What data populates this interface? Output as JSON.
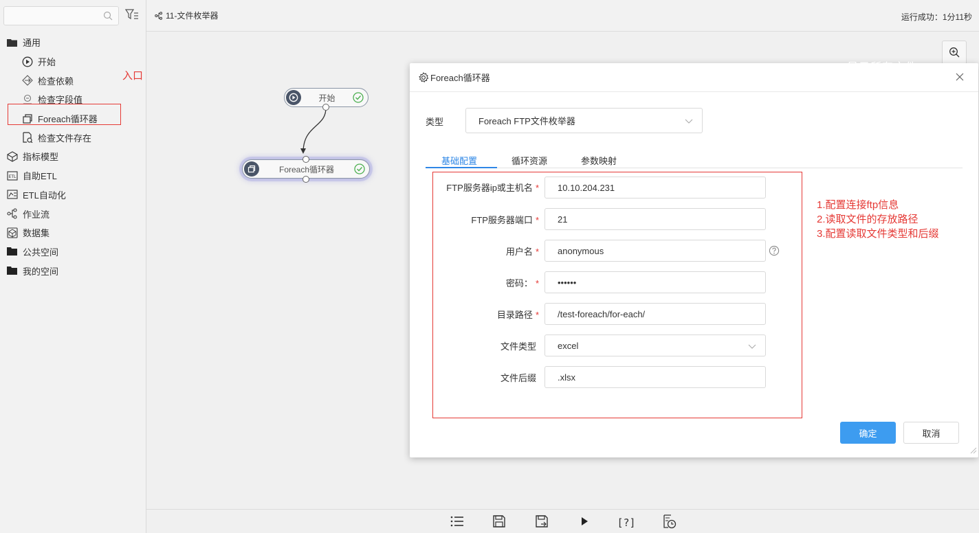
{
  "sidebar": {
    "search_placeholder": "",
    "tree": [
      {
        "label": "通用",
        "icon": "folder-open-icon"
      },
      {
        "label": "开始",
        "icon": "play-circle-icon"
      },
      {
        "label": "检查依赖",
        "icon": "dependency-icon"
      },
      {
        "label": "检查字段值",
        "icon": "field-check-icon"
      },
      {
        "label": "Foreach循环器",
        "icon": "foreach-loop-icon"
      },
      {
        "label": "检查文件存在",
        "icon": "file-check-icon"
      },
      {
        "label": "指标模型",
        "icon": "cube-icon"
      },
      {
        "label": "自助ETL",
        "icon": "etl-icon"
      },
      {
        "label": "ETL自动化",
        "icon": "etl-automation-icon"
      },
      {
        "label": "作业流",
        "icon": "workflow-icon"
      },
      {
        "label": "数据集",
        "icon": "dataset-icon"
      },
      {
        "label": "公共空间",
        "icon": "folder-icon"
      },
      {
        "label": "我的空间",
        "icon": "folder-icon"
      }
    ],
    "entry_annotation": "入口"
  },
  "topbar": {
    "flow_title": "11-文件枚举器",
    "run_status": "运行成功：1分11秒"
  },
  "canvas": {
    "nodes": [
      {
        "label": "开始",
        "status": "success"
      },
      {
        "label": "Foreach循环器",
        "status": "success"
      }
    ]
  },
  "modal": {
    "title": "Foreach循环器",
    "ghost_text": "显示所有文件",
    "type_label": "类型",
    "type_value": "Foreach FTP文件枚举器",
    "tabs": [
      "基础配置",
      "循环资源",
      "参数映射"
    ],
    "fields": [
      {
        "label": "FTP服务器ip或主机名",
        "required": "*",
        "value": "10.10.204.231"
      },
      {
        "label": "FTP服务器端口",
        "required": "*",
        "value": "21"
      },
      {
        "label": "用户名",
        "required": "*",
        "value": "anonymous"
      },
      {
        "label": "密码：",
        "required": "*",
        "value": "••••••"
      },
      {
        "label": "目录路径",
        "required": "*",
        "value": "/test-foreach/for-each/"
      },
      {
        "label": "文件类型",
        "required": "",
        "value": "excel"
      },
      {
        "label": "文件后缀",
        "required": "",
        "value": ".xlsx"
      }
    ],
    "annotations": [
      "1.配置连接ftp信息",
      "2.读取文件的存放路径",
      "3.配置读取文件类型和后缀"
    ],
    "ok_label": "确定",
    "cancel_label": "取消"
  },
  "toolbar": {
    "buttons": [
      "list-icon",
      "save-icon",
      "save-as-icon",
      "run-icon",
      "help-icon",
      "schedule-icon"
    ],
    "help_text": "[?]"
  },
  "colors": {
    "accent": "#3d9cf0",
    "annotation_red": "#e53935",
    "success_green": "#4caf50"
  }
}
